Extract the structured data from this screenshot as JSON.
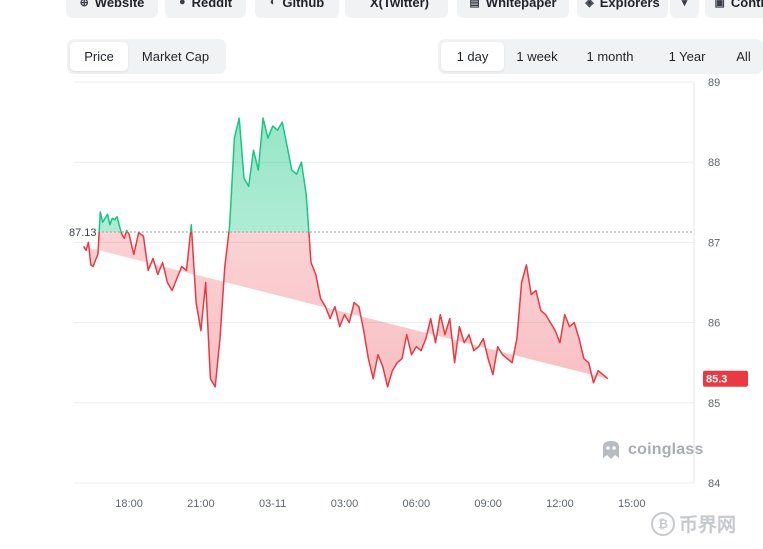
{
  "links": [
    {
      "label": "Website",
      "icon": "globe-icon",
      "glyph": "⊕"
    },
    {
      "label": "Reddit",
      "icon": "reddit-icon",
      "glyph": "●"
    },
    {
      "label": "Github",
      "icon": "github-icon",
      "glyph": "◐"
    },
    {
      "label": "X(Twitter)",
      "icon": "x-icon",
      "glyph": ""
    },
    {
      "label": "Whitepaper",
      "icon": "document-icon",
      "glyph": "▤"
    },
    {
      "label": "Explorers",
      "icon": "explorer-icon",
      "glyph": "◈"
    },
    {
      "label": "",
      "icon": "chevron-down-icon",
      "glyph": "▾"
    },
    {
      "label": "Contr",
      "icon": "contract-icon",
      "glyph": "▣"
    }
  ],
  "metric_tabs": {
    "active": "Price",
    "items": [
      "Price",
      "Market Cap"
    ]
  },
  "range_tabs": {
    "active": "1 day",
    "items": [
      "1 day",
      "1 week",
      "1 month",
      "1 Year",
      "All"
    ]
  },
  "watermark": "coinglass",
  "corner_watermark": "币界网",
  "colors": {
    "up": "#16c784",
    "down": "#ea3943",
    "up_fill": "#bdeccf",
    "down_fill": "#f6c5ca",
    "grid": "#ebedf0",
    "axis_text": "#5f6670"
  },
  "chart_data": {
    "type": "line",
    "title": "",
    "xlabel": "",
    "ylabel": "",
    "baseline": 87.13,
    "baseline_label": "87.13",
    "last_price": 85.3,
    "last_price_label": "85.3",
    "ylim": [
      84,
      89
    ],
    "yticks": [
      "89",
      "88",
      "87",
      "86",
      "85",
      "84"
    ],
    "xticks": [
      "18:00",
      "21:00",
      "03-11",
      "03:00",
      "06:00",
      "09:00",
      "12:00",
      "15:00"
    ],
    "xtick_hours": [
      18,
      21,
      24,
      27,
      30,
      33,
      36,
      39
    ],
    "grid": true,
    "series": [
      {
        "x_hours": [
          16.1,
          16.2,
          16.3,
          16.4,
          16.5,
          16.6,
          16.7,
          16.8,
          16.9,
          17.0,
          17.1,
          17.2,
          17.3,
          17.4,
          17.5,
          17.6,
          17.7,
          17.8,
          17.9,
          18.0,
          18.2,
          18.4,
          18.6,
          18.8,
          19.0,
          19.2,
          19.4,
          19.6,
          19.8,
          20.0,
          20.2,
          20.4,
          20.6,
          20.8,
          21.0,
          21.2,
          21.4,
          21.6,
          21.8,
          22.0,
          22.2,
          22.4,
          22.6,
          22.8,
          23.0,
          23.2,
          23.4,
          23.6,
          23.8,
          24.0,
          24.2,
          24.4,
          24.6,
          24.8,
          25.0,
          25.2,
          25.4,
          25.6,
          25.8,
          26.0,
          26.2,
          26.4,
          26.6,
          26.8,
          27.0,
          27.2,
          27.4,
          27.6,
          27.8,
          28.0,
          28.2,
          28.4,
          28.6,
          28.8,
          29.0,
          29.2,
          29.4,
          29.6,
          29.8,
          30.0,
          30.2,
          30.4,
          30.6,
          30.8,
          31.0,
          31.2,
          31.4,
          31.6,
          31.8,
          32.0,
          32.2,
          32.4,
          32.6,
          32.8,
          33.0,
          33.2,
          33.4,
          33.6,
          33.8,
          34.0,
          34.2,
          34.4,
          34.6,
          34.8,
          35.0,
          35.2,
          35.4,
          35.6,
          35.8,
          36.0,
          36.2,
          36.4,
          36.6,
          36.8,
          37.0,
          37.2,
          37.4,
          37.6,
          37.8,
          38.0,
          38.2,
          38.4,
          38.6,
          38.8,
          39.0,
          39.2,
          39.4,
          39.6,
          39.8,
          40.0,
          40.2,
          40.4,
          40.6,
          40.8,
          41.0,
          41.2,
          41.4
        ],
        "values": [
          86.95,
          86.9,
          87.0,
          86.72,
          86.7,
          86.78,
          86.85,
          87.38,
          87.25,
          87.3,
          87.35,
          87.22,
          87.3,
          87.28,
          87.32,
          87.2,
          87.1,
          87.05,
          87.15,
          87.1,
          86.85,
          87.12,
          87.08,
          86.65,
          86.8,
          86.6,
          86.75,
          86.5,
          86.4,
          86.55,
          86.7,
          86.65,
          87.22,
          86.25,
          85.9,
          86.5,
          85.3,
          85.2,
          85.8,
          86.7,
          87.2,
          88.3,
          88.55,
          87.8,
          87.7,
          88.15,
          87.9,
          88.55,
          88.3,
          88.45,
          88.4,
          88.5,
          88.2,
          87.9,
          87.85,
          88.0,
          87.6,
          86.75,
          86.6,
          86.3,
          86.2,
          86.05,
          86.2,
          85.95,
          86.1,
          86.0,
          86.25,
          86.2,
          85.9,
          85.55,
          85.3,
          85.6,
          85.45,
          85.2,
          85.4,
          85.5,
          85.55,
          85.85,
          85.6,
          85.7,
          85.65,
          85.8,
          86.05,
          85.75,
          86.1,
          85.85,
          86.05,
          85.5,
          85.95,
          85.75,
          85.85,
          85.65,
          85.7,
          85.8,
          85.55,
          85.35,
          85.7,
          85.6,
          85.55,
          85.5,
          85.8,
          86.5,
          86.72,
          86.35,
          86.4,
          86.15,
          86.1,
          86.0,
          85.9,
          85.75,
          86.1,
          85.95,
          86.0,
          85.8,
          85.55,
          85.5,
          85.25,
          85.4,
          85.35,
          85.3
        ],
        "color_above": "#16c784",
        "color_below": "#ea3943"
      }
    ]
  }
}
